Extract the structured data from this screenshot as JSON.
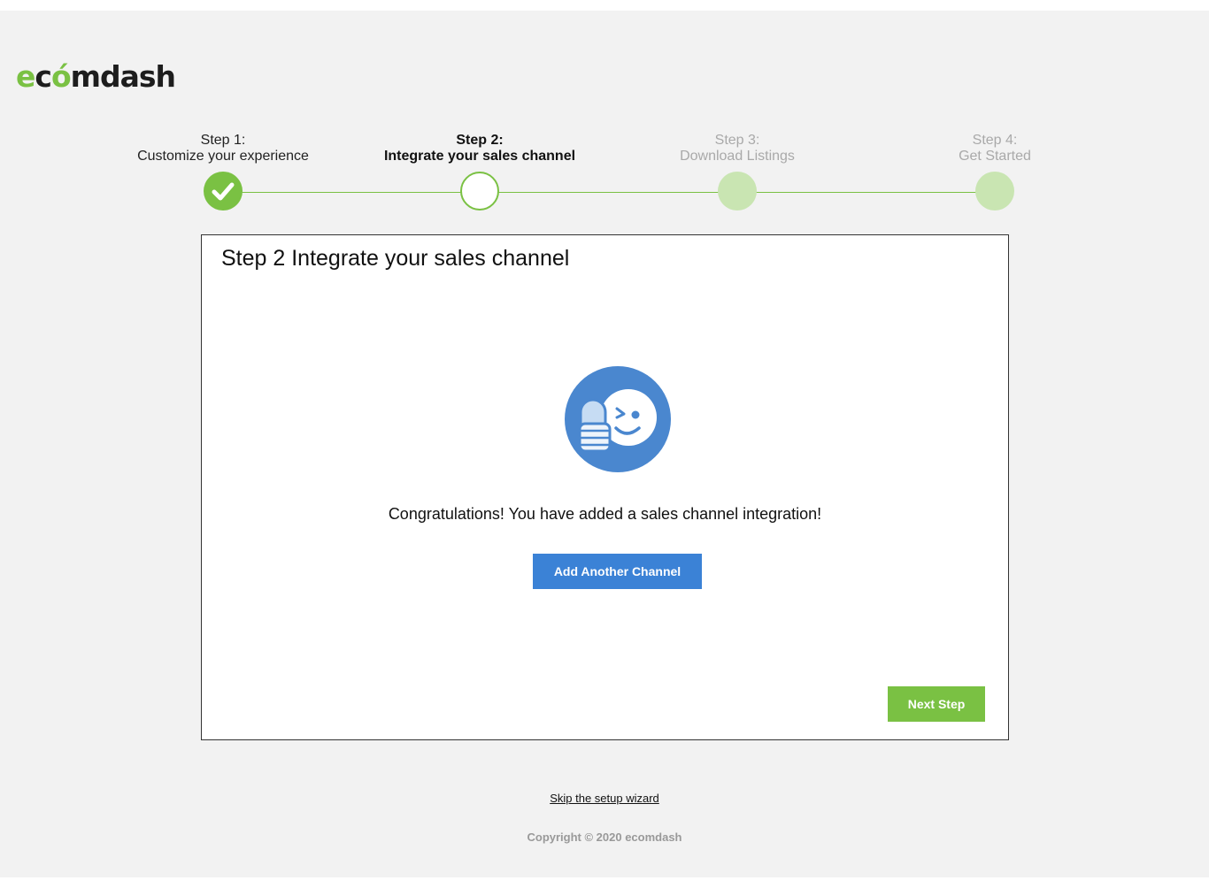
{
  "brand": {
    "logo_parts": [
      "e",
      "c",
      "ó",
      "mdash"
    ],
    "accent_color": "#7ac143",
    "dark_color": "#1d1d1d"
  },
  "stepper": {
    "steps": [
      {
        "title": "Step 1:",
        "subtitle": "Customize your experience",
        "state": "complete"
      },
      {
        "title": "Step 2:",
        "subtitle": "Integrate your sales channel",
        "state": "active"
      },
      {
        "title": "Step 3:",
        "subtitle": "Download Listings",
        "state": "upcoming"
      },
      {
        "title": "Step 4:",
        "subtitle": "Get Started",
        "state": "upcoming"
      }
    ],
    "check_icon": "check-icon"
  },
  "card": {
    "title": "Step 2 Integrate your sales channel",
    "icon": "thumbs-up-wink-icon",
    "message": "Congratulations! You have added a sales channel integration!",
    "add_channel_label": "Add Another Channel",
    "next_label": "Next Step"
  },
  "footer": {
    "skip_label": "Skip the setup wizard",
    "copyright": "Copyright © 2020 ecomdash"
  },
  "colors": {
    "primary_blue": "#3b82d6",
    "success_green": "#7ac143",
    "inactive_green": "#c9e5b2",
    "page_background": "#f2f2f2"
  }
}
